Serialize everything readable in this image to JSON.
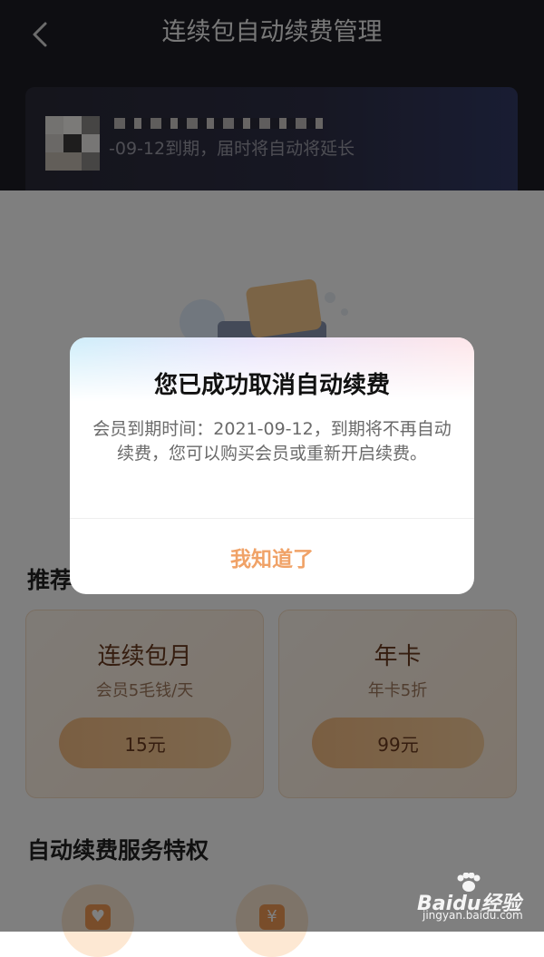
{
  "header": {
    "title": "连续包自动续费管理",
    "back_icon": "chevron-left-icon",
    "member_status": "-09-12到期，届时将自动将延长"
  },
  "sections": {
    "recommend": "推荐",
    "privileges": "自动续费服务特权"
  },
  "plans": [
    {
      "name": "连续包月",
      "desc": "会员5毛钱/天",
      "price": "15元"
    },
    {
      "name": "年卡",
      "desc": "年卡5折",
      "price": "99元"
    }
  ],
  "privilege_icons": [
    "heart-icon",
    "yuan-icon"
  ],
  "dialog": {
    "title": "您已成功取消自动续费",
    "message": "会员到期时间：2021-09-12，到期将不再自动续费，您可以购买会员或重新开启续费。",
    "confirm": "我知道了"
  },
  "watermark": {
    "brand": "Baidu经验",
    "url": "jingyan.baidu.com"
  },
  "colors": {
    "accent": "#f0a267",
    "header_bg": "#1c1c24",
    "overlay": "rgba(0,0,0,0.5)"
  }
}
